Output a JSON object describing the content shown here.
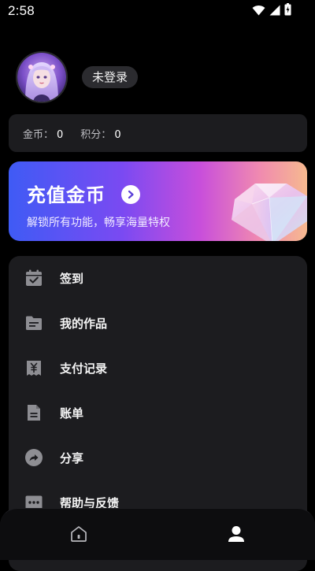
{
  "status_bar": {
    "time": "2:58",
    "icons": [
      "wifi-icon",
      "signal-icon",
      "battery-icon"
    ]
  },
  "profile": {
    "login_status": "未登录"
  },
  "stats": {
    "coins_label": "金币：",
    "coins_value": "0",
    "points_label": "积分：",
    "points_value": "0"
  },
  "banner": {
    "title": "充值金币",
    "subtitle": "解锁所有功能，畅享海量特权"
  },
  "menu": {
    "items": [
      {
        "label": "签到",
        "icon": "calendar-check-icon"
      },
      {
        "label": "我的作品",
        "icon": "folder-icon"
      },
      {
        "label": "支付记录",
        "icon": "payment-record-icon"
      },
      {
        "label": "账单",
        "icon": "document-icon"
      },
      {
        "label": "分享",
        "icon": "share-icon"
      },
      {
        "label": "帮助与反馈",
        "icon": "feedback-icon"
      }
    ]
  },
  "bottom_nav": {
    "items": [
      {
        "icon": "home-icon",
        "active": false
      },
      {
        "icon": "user-icon",
        "active": true
      }
    ]
  },
  "colors": {
    "background": "#000000",
    "card": "#1c1c1f",
    "icon_gray": "#8e8e93",
    "banner_gradient_start": "#3f5bf5",
    "banner_gradient_end": "#f6b98f"
  }
}
